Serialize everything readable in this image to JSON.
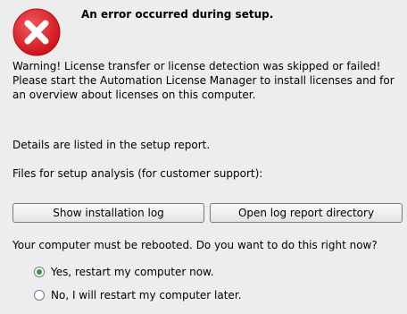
{
  "dialog": {
    "icon": "error-icon",
    "headline": "An error occurred during setup.",
    "warning_text": "Warning! License transfer or license detection was skipped or failed! Please start the Automation License Manager to install licenses and for an overview about licenses on this computer.",
    "details_text": "Details are listed in the setup report.",
    "files_text": "Files for setup analysis (for customer support):"
  },
  "buttons": {
    "show_log": "Show installation log",
    "open_dir": "Open log report directory"
  },
  "reboot": {
    "question": "Your computer must be rebooted. Do you want to do this right now?",
    "options": [
      {
        "label": "Yes, restart my computer now.",
        "selected": true
      },
      {
        "label": "No, I will restart my computer later.",
        "selected": false
      }
    ]
  },
  "colors": {
    "icon_red": "#e0242d",
    "background": "#ededed",
    "radio_accent": "#3c8f3c"
  }
}
